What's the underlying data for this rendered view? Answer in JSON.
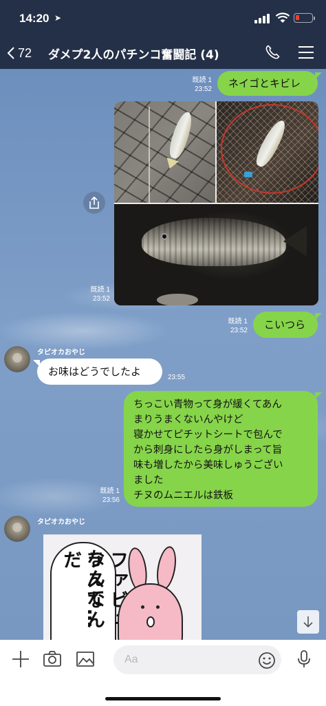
{
  "status_bar": {
    "time": "14:20"
  },
  "header": {
    "back_count": "72",
    "title": "ダメプ2人のパチンコ奮闘記 (4)"
  },
  "messages": [
    {
      "type": "outgoing-text",
      "read_label": "既読 1",
      "time": "23:52",
      "text": "ネイゴとキビレ"
    },
    {
      "type": "outgoing-photos",
      "read_label": "既読 1",
      "time": "23:52"
    },
    {
      "type": "outgoing-text",
      "read_label": "既読 1",
      "time": "23:52",
      "text": "こいつら"
    },
    {
      "type": "incoming-text",
      "sender": "タピオカおやじ",
      "time": "23:55",
      "text": "お味はどうでしたよ"
    },
    {
      "type": "outgoing-text",
      "read_label": "既読 1",
      "time": "23:56",
      "lines": [
        "ちっこい青物って身が緩くてあん",
        "まりうまくないんやけど",
        "寝かせてピチットシートで包んで",
        "から刺身にしたら身がしまって旨",
        "味も増したから美味しゅうござい",
        "ました",
        "チヌのムニエルは鉄板"
      ]
    },
    {
      "type": "incoming-sticker",
      "sender": "タピオカおやじ",
      "sticker_text_col1": "なんて…",
      "sticker_text_col2": "ファビュラスなんだ"
    }
  ],
  "input_bar": {
    "placeholder": "Aa"
  },
  "colors": {
    "header_bg": "#243047",
    "outgoing_bubble": "#86d44a",
    "incoming_bubble": "#ffffff",
    "chat_bg": "#7d9cc4"
  },
  "icons": [
    "location-arrow-icon",
    "signal-icon",
    "wifi-icon",
    "battery-icon",
    "chevron-left-icon",
    "phone-icon",
    "hamburger-menu-icon",
    "share-icon",
    "scroll-down-arrow-icon",
    "plus-icon",
    "camera-icon",
    "image-icon",
    "emoji-icon",
    "microphone-icon"
  ]
}
